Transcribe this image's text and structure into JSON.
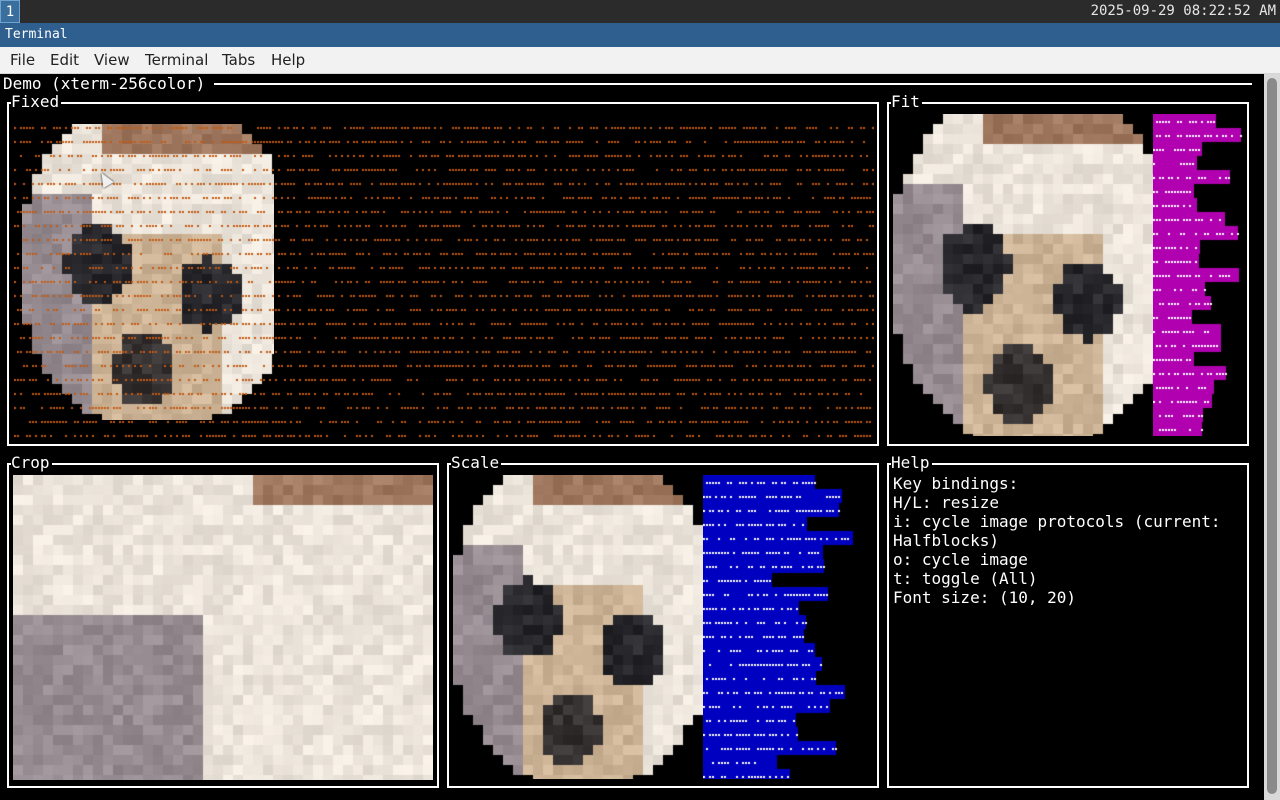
{
  "taskbar": {
    "workspace": "1",
    "clock": "2025-09-29 08:22:52 AM"
  },
  "window": {
    "title": "Terminal"
  },
  "menu": [
    "File",
    "Edit",
    "View",
    "Terminal",
    "Tabs",
    "Help"
  ],
  "app": {
    "title": "Demo (xterm-256color)"
  },
  "panels": {
    "fixed": {
      "title": "Fixed"
    },
    "fit": {
      "title": "Fit"
    },
    "crop": {
      "title": "Crop"
    },
    "scale": {
      "title": "Scale"
    },
    "help": {
      "title": "Help",
      "lines": [
        "Key bindings:",
        "H/L: resize",
        "i: cycle image protocols (current:",
        "Halfblocks)",
        "o: cycle image",
        "t: toggle (All)",
        "Font size: (10, 20)"
      ]
    }
  },
  "colors": {
    "fixed_dots": "#c45a12",
    "fit_bg": "#b000b0",
    "scale_bg": "#0000c0",
    "terminal_bg": "#000000"
  }
}
